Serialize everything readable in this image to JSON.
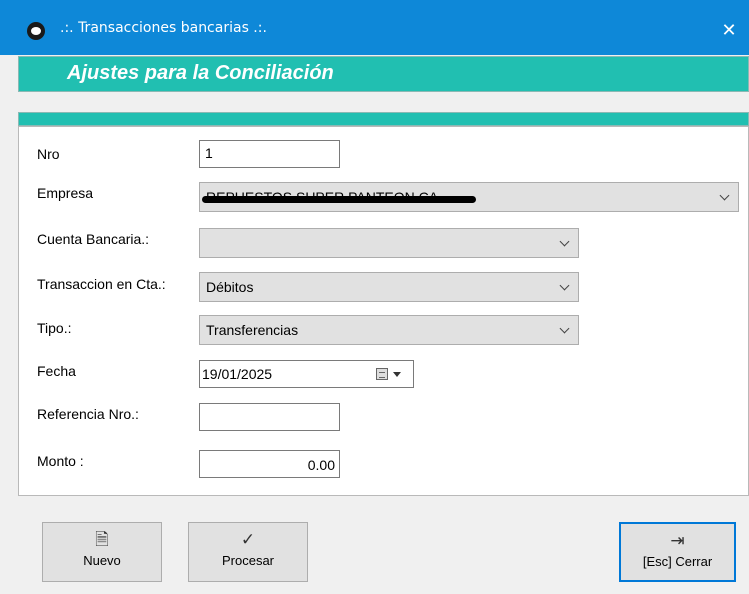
{
  "window": {
    "title": ".:. Transacciones bancarias .:.",
    "close_glyph": "✕"
  },
  "header": {
    "title": "Ajustes para la Conciliación"
  },
  "form": {
    "nro": {
      "label": "Nro",
      "value": "1"
    },
    "empresa": {
      "label": "Empresa",
      "value": "REPUESTOS SUPER PANTEON CA"
    },
    "cuenta": {
      "label": "Cuenta Bancaria.:",
      "value": ""
    },
    "transaccion": {
      "label": "Transaccion en Cta.:",
      "value": "Débitos"
    },
    "tipo": {
      "label": "Tipo.:",
      "value": "Transferencias"
    },
    "fecha": {
      "label": "Fecha",
      "value": "19/01/2025"
    },
    "referencia": {
      "label": "Referencia Nro.:",
      "value": ""
    },
    "monto": {
      "label": "Monto :",
      "value": "0.00"
    }
  },
  "buttons": {
    "nuevo": {
      "label": "Nuevo",
      "icon": "new-document-icon"
    },
    "procesar": {
      "label": "Procesar",
      "icon": "check-icon"
    },
    "cerrar": {
      "label": "[Esc] Cerrar",
      "icon": "exit-door-icon"
    }
  }
}
